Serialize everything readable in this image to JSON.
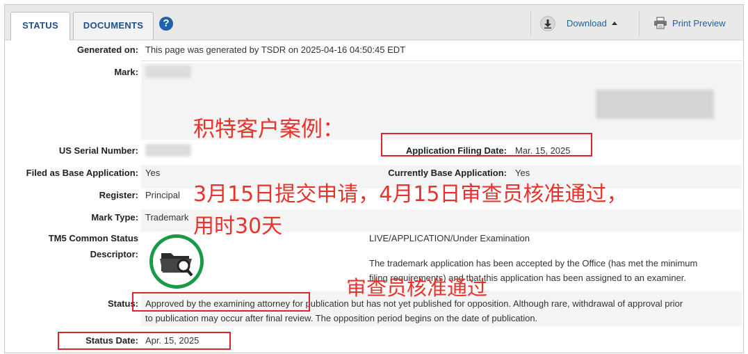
{
  "tabs": [
    {
      "label": "STATUS",
      "active": true
    },
    {
      "label": "DOCUMENTS",
      "active": false
    }
  ],
  "toolbar": {
    "help_glyph": "?",
    "download_label": "Download",
    "print_label": "Print Preview",
    "icons": {
      "download": "download-icon",
      "print": "printer-icon",
      "help": "help-icon"
    }
  },
  "fields": {
    "generated_on": {
      "label": "Generated on:",
      "value": "This page was generated by TSDR on 2025-04-16 04:50:45 EDT"
    },
    "mark": {
      "label": "Mark:"
    },
    "us_serial": {
      "label": "US Serial Number:"
    },
    "filing_date": {
      "label": "Application Filing Date:",
      "value": "Mar. 15, 2025"
    },
    "filed_base": {
      "label": "Filed as Base Application:",
      "value": "Yes"
    },
    "current_base": {
      "label": "Currently Base Application:",
      "value": "Yes"
    },
    "register": {
      "label": "Register:",
      "value": "Principal"
    },
    "mark_type": {
      "label": "Mark Type:",
      "value": "Trademark"
    },
    "tm5": {
      "label_line1": "TM5 Common Status",
      "label_line2": "Descriptor:",
      "status_title": "LIVE/APPLICATION/Under Examination",
      "desc_line1": "The trademark application has been accepted by the Office (has met the minimum",
      "desc_line2": "filing requirements) and that this application has been assigned to an examiner."
    },
    "status": {
      "label": "Status:",
      "line1": "Approved by the examining attorney for publication but has not yet published for opposition. Although rare, withdrawal of approval prior",
      "line2": "to publication may occur after final review. The opposition period begins on the date of publication."
    },
    "status_date": {
      "label": "Status Date:",
      "value": "Apr. 15, 2025"
    }
  },
  "annotations": {
    "case_title": "积特客户案例：",
    "timeline_line1": "3月15日提交申请，4月15日审查员核准通过，",
    "timeline_line2": "用时30天",
    "approved": "审查员核准通过",
    "color": "#e8322b"
  }
}
